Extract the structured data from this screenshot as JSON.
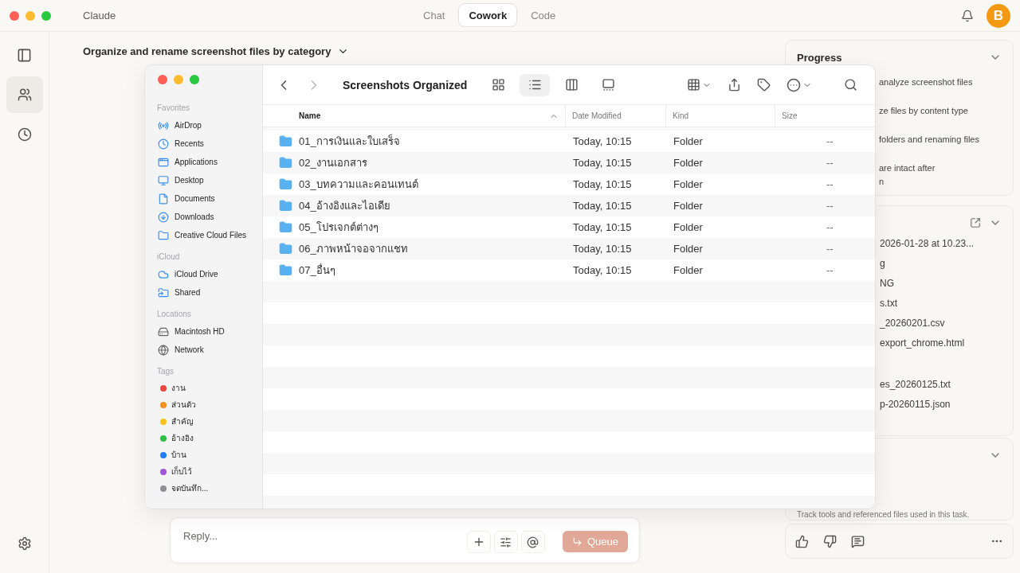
{
  "app": {
    "title": "Claude"
  },
  "mode_tabs": [
    {
      "label": "Chat",
      "selected": false
    },
    {
      "label": "Cowork",
      "selected": true
    },
    {
      "label": "Code",
      "selected": false
    }
  ],
  "avatar": {
    "initial": "B"
  },
  "rail": [
    {
      "kind": "panel",
      "selected": false
    },
    {
      "kind": "people",
      "selected": true
    },
    {
      "kind": "history",
      "selected": false
    }
  ],
  "task": {
    "title": "Organize and rename screenshot files by category"
  },
  "finder": {
    "title": "Screenshots Organized",
    "view_modes": [
      {
        "kind": "icons",
        "selected": false
      },
      {
        "kind": "list",
        "selected": true
      },
      {
        "kind": "columns",
        "selected": false
      },
      {
        "kind": "gallery",
        "selected": false
      }
    ],
    "sidebar": [
      {
        "heading": "Favorites",
        "items": [
          {
            "label": "AirDrop",
            "kind": "airdrop"
          },
          {
            "label": "Recents",
            "kind": "recents"
          },
          {
            "label": "Applications",
            "kind": "apps"
          },
          {
            "label": "Desktop",
            "kind": "desktop"
          },
          {
            "label": "Documents",
            "kind": "doc"
          },
          {
            "label": "Downloads",
            "kind": "download"
          },
          {
            "label": "Creative Cloud Files",
            "kind": "folder"
          }
        ]
      },
      {
        "heading": "iCloud",
        "items": [
          {
            "label": "iCloud Drive",
            "kind": "cloud"
          },
          {
            "label": "Shared",
            "kind": "shared"
          }
        ]
      },
      {
        "heading": "Locations",
        "items": [
          {
            "label": "Macintosh HD",
            "kind": "disk"
          },
          {
            "label": "Network",
            "kind": "globe"
          }
        ]
      }
    ],
    "tags_heading": "Tags",
    "tags": [
      {
        "label": "งาน",
        "color": "#f0463c"
      },
      {
        "label": "ส่วนตัว",
        "color": "#f5901e"
      },
      {
        "label": "สำคัญ",
        "color": "#f7c218"
      },
      {
        "label": "อ้างอิง",
        "color": "#2cc13f"
      },
      {
        "label": "บ้าน",
        "color": "#1f7cf5"
      },
      {
        "label": "เก็บไว้",
        "color": "#a552d8"
      },
      {
        "label": "จดบันทึก...",
        "color": "#8e8e93"
      }
    ],
    "columns": [
      "Name",
      "Date Modified",
      "Kind",
      "Size"
    ],
    "rows": [
      {
        "name": "01_การเงินและใบเสร็จ",
        "date_modified": "Today, 10:15",
        "kind": "Folder",
        "size": "--"
      },
      {
        "name": "02_งานเอกสาร",
        "date_modified": "Today, 10:15",
        "kind": "Folder",
        "size": "--"
      },
      {
        "name": "03_บทความและคอนเทนต์",
        "date_modified": "Today, 10:15",
        "kind": "Folder",
        "size": "--"
      },
      {
        "name": "04_อ้างอิงและไอเดีย",
        "date_modified": "Today, 10:15",
        "kind": "Folder",
        "size": "--"
      },
      {
        "name": "05_โปรเจกต์ต่างๆ",
        "date_modified": "Today, 10:15",
        "kind": "Folder",
        "size": "--"
      },
      {
        "name": "06_ภาพหน้าจอจากแชท",
        "date_modified": "Today, 10:15",
        "kind": "Folder",
        "size": "--"
      },
      {
        "name": "07_อื่นๆ",
        "date_modified": "Today, 10:15",
        "kind": "Folder",
        "size": "--"
      }
    ]
  },
  "progress": {
    "title": "Progress",
    "steps": [
      "analyze screenshot files",
      "ze files by content type",
      "folders and renaming files",
      "are intact after\nn"
    ]
  },
  "files_card": {
    "groups": [
      [
        "2026-01-28 at 10.23...",
        "g",
        "NG",
        "s.txt",
        "_20260201.csv",
        "export_chrome.html"
      ],
      [
        "es_20260125.txt",
        "p-20260115.json"
      ]
    ]
  },
  "context_card": {
    "description": "Track tools and referenced files used in this task."
  },
  "composer": {
    "placeholder": "Reply...",
    "send_label": "Queue",
    "send_disabled": true
  }
}
